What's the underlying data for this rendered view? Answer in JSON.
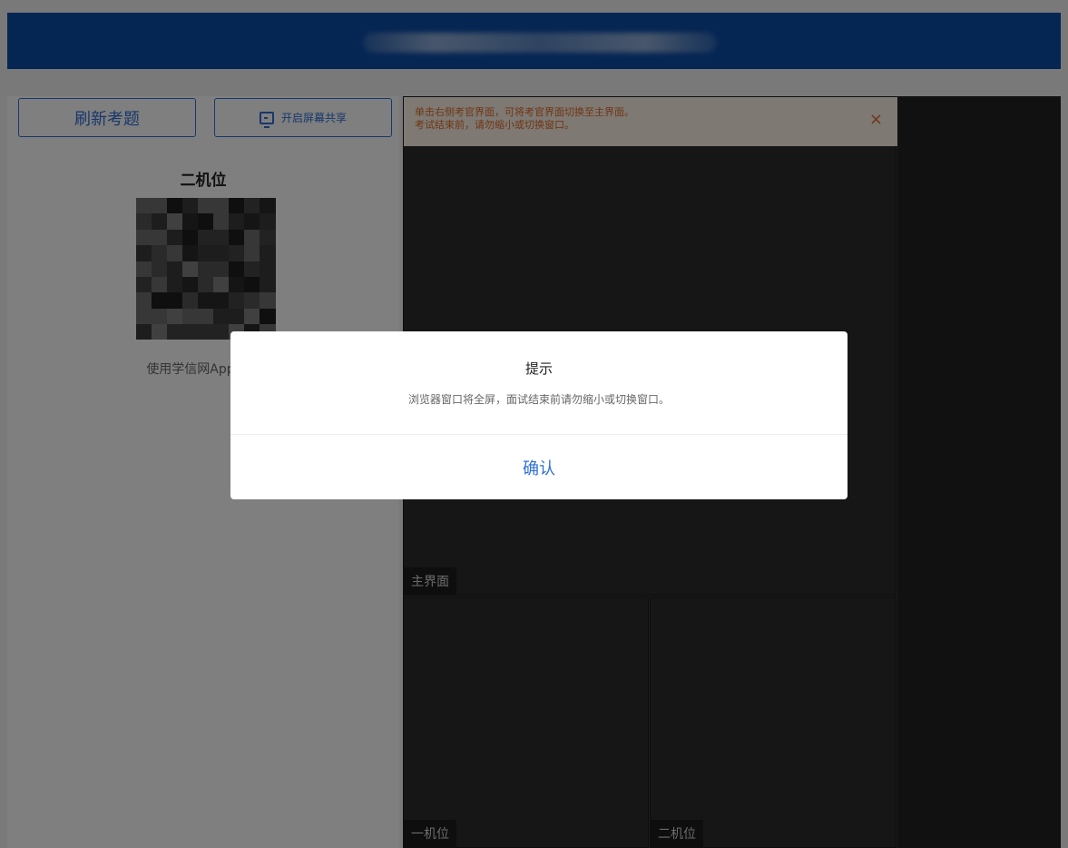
{
  "left_panel": {
    "refresh_button": "刷新考题",
    "share_button": "开启屏幕共享",
    "position_title": "二机位",
    "scan_tip": "使用学信网App扫描"
  },
  "notice": {
    "line1": "单击右侧考官界面，可将考官界面切换至主界面。",
    "line2": "考试结束前，请勿缩小或切换窗口。",
    "close": "×"
  },
  "views": {
    "main_label": "主界面",
    "camera1_label": "一机位",
    "camera2_label": "二机位"
  },
  "dialog": {
    "title": "提示",
    "message": "浏览器窗口将全屏，面试结束前请勿缩小或切换窗口。",
    "confirm": "确认"
  },
  "colors": {
    "accent": "#2f6fd6",
    "topbar": "#0a4aa6",
    "notice_text": "#e06a2a"
  }
}
